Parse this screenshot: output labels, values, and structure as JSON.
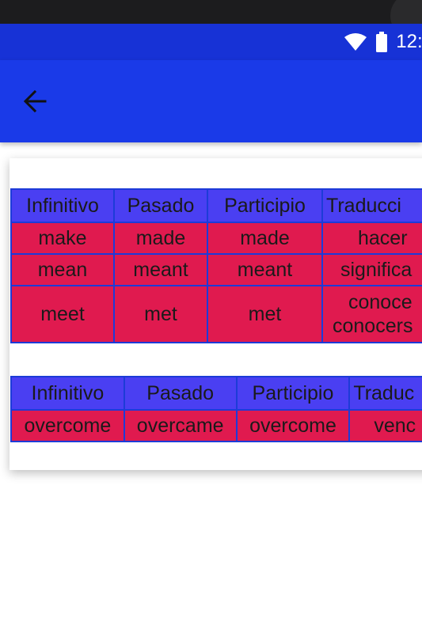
{
  "status_bar": {
    "time": "12:3"
  },
  "app_bar": {
    "back_icon": "arrow-left-icon"
  },
  "table1": {
    "headers": [
      "Infinitivo",
      "Pasado",
      "Participio",
      "Traducci"
    ],
    "rows": [
      [
        "make",
        "made",
        "made",
        "hacer"
      ],
      [
        "mean",
        "meant",
        "meant",
        "significa"
      ],
      [
        "meet",
        "met",
        "met",
        "conoce",
        "conocers"
      ]
    ]
  },
  "table2": {
    "headers": [
      "Infinitivo",
      "Pasado",
      "Participio",
      "Traduc"
    ],
    "rows": [
      [
        "overcome",
        "overcame",
        "overcome",
        "venc"
      ]
    ]
  },
  "colors": {
    "status_bar": "#1732d6",
    "app_bar": "#1a3ae8",
    "header_cell": "#4a3ff2",
    "body_cell": "#e01a4f",
    "cell_border": "#1d3bd8"
  }
}
